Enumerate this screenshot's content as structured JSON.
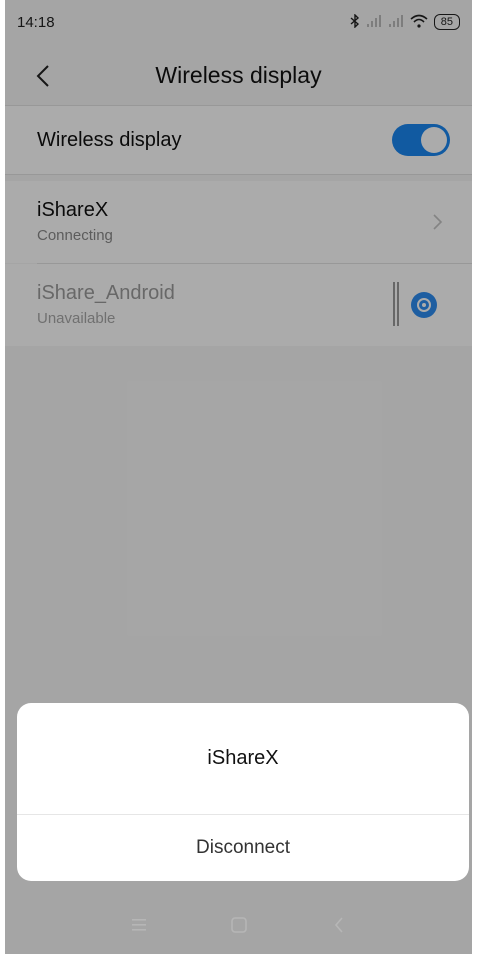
{
  "status_bar": {
    "time": "14:18",
    "battery": "85",
    "icons": [
      "bluetooth-icon",
      "signal-icon",
      "signal-icon",
      "wifi-icon",
      "battery-icon"
    ]
  },
  "header": {
    "title": "Wireless display",
    "back_icon": "back-arrow-icon"
  },
  "settings": {
    "wireless_display_label": "Wireless display",
    "wireless_display_enabled": true
  },
  "devices": [
    {
      "name": "iShareX",
      "status": "Connecting",
      "action_icon": "chevron-right-icon"
    },
    {
      "name": "iShare_Android",
      "status": "Unavailable",
      "action_icon": "gear-icon"
    }
  ],
  "dialog": {
    "title": "iShareX",
    "action_label": "Disconnect"
  },
  "nav_bar": {
    "icons": [
      "menu-icon",
      "home-icon",
      "back-icon"
    ]
  },
  "colors": {
    "accent": "#1a86f0",
    "overlay": "#000000"
  }
}
